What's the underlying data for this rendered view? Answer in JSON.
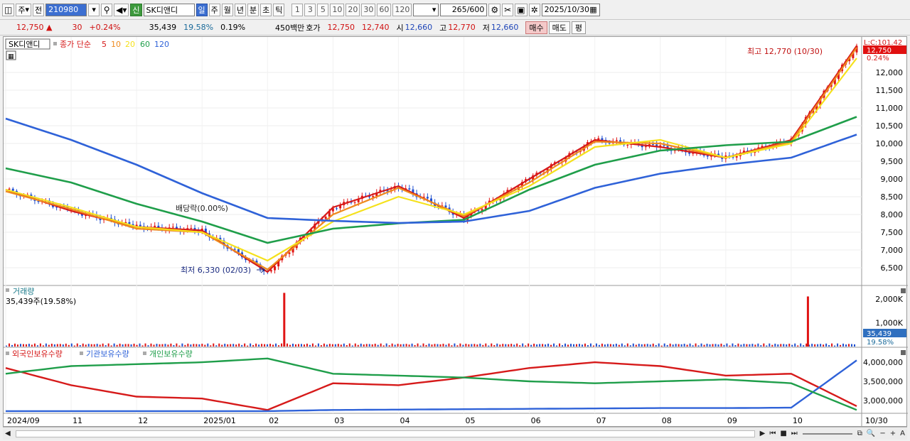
{
  "toolbar": {
    "market": "주",
    "scope": "전",
    "code": "210980",
    "name": "SK디앤디",
    "badge_new": "신",
    "periods": [
      "일",
      "주",
      "월",
      "년",
      "분",
      "초",
      "틱"
    ],
    "minutes": [
      "1",
      "3",
      "5",
      "10",
      "20",
      "30",
      "60",
      "120"
    ],
    "count": "265",
    "count_total": "/600",
    "date": "2025/10/30"
  },
  "quote": {
    "price": "12,750",
    "up_arrow": "▲",
    "change": "30",
    "change_pct": "+0.24%",
    "volume": "35,439",
    "turnover": "19.58%",
    "rate2": "0.19%",
    "amount": "450백만",
    "hoga_label": "호가",
    "ask": "12,750",
    "bid": "12,740",
    "open_label": "시",
    "open": "12,660",
    "high_label": "고",
    "high": "12,770",
    "low_label": "저",
    "low": "12,660",
    "buy_label": "매수",
    "sell_label": "매도",
    "eval_label": "평"
  },
  "chart": {
    "title": "SK디앤디",
    "legend_label": "종가 단순",
    "ma_periods": [
      "5",
      "10",
      "20",
      "60",
      "120"
    ],
    "ma_colors": [
      "#d61a1a",
      "#ef8a1d",
      "#f5e11c",
      "#1f9e4a",
      "#2f62d8"
    ],
    "axis_top": "L:C:101.42",
    "price_ticks": [
      "12,000",
      "11,500",
      "11,000",
      "10,500",
      "10,000",
      "9,500",
      "9,000",
      "8,500",
      "8,000",
      "7,500",
      "7,000",
      "6,500"
    ],
    "current_price_label": "12,750",
    "current_pct_label": "0.24%",
    "high_annotation": "최고 12,770 (10/30)",
    "low_annotation": "최저 6,330 (02/03)",
    "dividend_annotation": "배당락(0.00%)",
    "volume_title": "거래량",
    "volume_sub": "35,439주(19.58%)",
    "volume_ticks": [
      "2,000K",
      "1,000K"
    ],
    "volume_label": "35,439",
    "volume_pct_label": "19.58%",
    "holdings_legend": [
      "외국인보유수량",
      "기관보유수량",
      "개인보유수량"
    ],
    "holdings_colors": [
      "#d61a1a",
      "#2f62d8",
      "#1f9e4a"
    ],
    "holdings_ticks": [
      "4,000,000",
      "3,500,000",
      "3,000,000"
    ],
    "x_labels": [
      "2024/09",
      "11",
      "12",
      "2025/01",
      "02",
      "03",
      "04",
      "05",
      "06",
      "07",
      "08",
      "09",
      "10",
      "10/30"
    ]
  },
  "chart_data": {
    "type": "line",
    "title": "",
    "x": [
      "2024/09",
      "11",
      "12",
      "2025/01",
      "02",
      "03",
      "04",
      "05",
      "06",
      "07",
      "08",
      "09",
      "10",
      "10/30"
    ],
    "ylim": [
      6100,
      12900
    ],
    "series": [
      {
        "name": "5",
        "values": [
          8700,
          8100,
          7650,
          7550,
          6380,
          8200,
          8800,
          7900,
          9000,
          10100,
          9900,
          9600,
          10100,
          12750
        ]
      },
      {
        "name": "10",
        "values": [
          8650,
          8150,
          7600,
          7500,
          6450,
          8000,
          8750,
          7950,
          8900,
          10050,
          10000,
          9600,
          10050,
          12700
        ]
      },
      {
        "name": "20",
        "values": [
          8700,
          8200,
          7650,
          7500,
          6700,
          7800,
          8500,
          8000,
          8800,
          9900,
          10100,
          9600,
          10000,
          12400
        ]
      },
      {
        "name": "60",
        "values": [
          9300,
          8900,
          8300,
          7800,
          7200,
          7600,
          7750,
          7850,
          8700,
          9400,
          9800,
          9950,
          10050,
          10750
        ]
      },
      {
        "name": "120",
        "values": [
          10700,
          10100,
          9400,
          8600,
          7900,
          7820,
          7760,
          7800,
          8100,
          8750,
          9150,
          9400,
          9600,
          10250
        ]
      }
    ],
    "volume": {
      "ticks": [
        "2,000K",
        "1,000K"
      ],
      "spikes": [
        {
          "x": "02",
          "value": 2250
        },
        {
          "x": "10",
          "value": 2100
        }
      ]
    },
    "holdings": {
      "ylim": [
        2700000,
        4300000
      ],
      "series": [
        {
          "name": "외국인보유수량",
          "values": [
            3850000,
            3400000,
            3100000,
            3050000,
            2750000,
            3450000,
            3400000,
            3600000,
            3850000,
            4000000,
            3900000,
            3650000,
            3700000,
            2850000
          ]
        },
        {
          "name": "기관보유수량",
          "values": [
            2720000,
            2720000,
            2720000,
            2720000,
            2720000,
            2750000,
            2760000,
            2770000,
            2780000,
            2790000,
            2800000,
            2800000,
            2810000,
            4050000
          ]
        },
        {
          "name": "개인보유수량",
          "values": [
            3700000,
            3900000,
            3950000,
            4000000,
            4100000,
            3700000,
            3650000,
            3600000,
            3500000,
            3450000,
            3500000,
            3550000,
            3450000,
            2750000
          ]
        }
      ]
    }
  }
}
